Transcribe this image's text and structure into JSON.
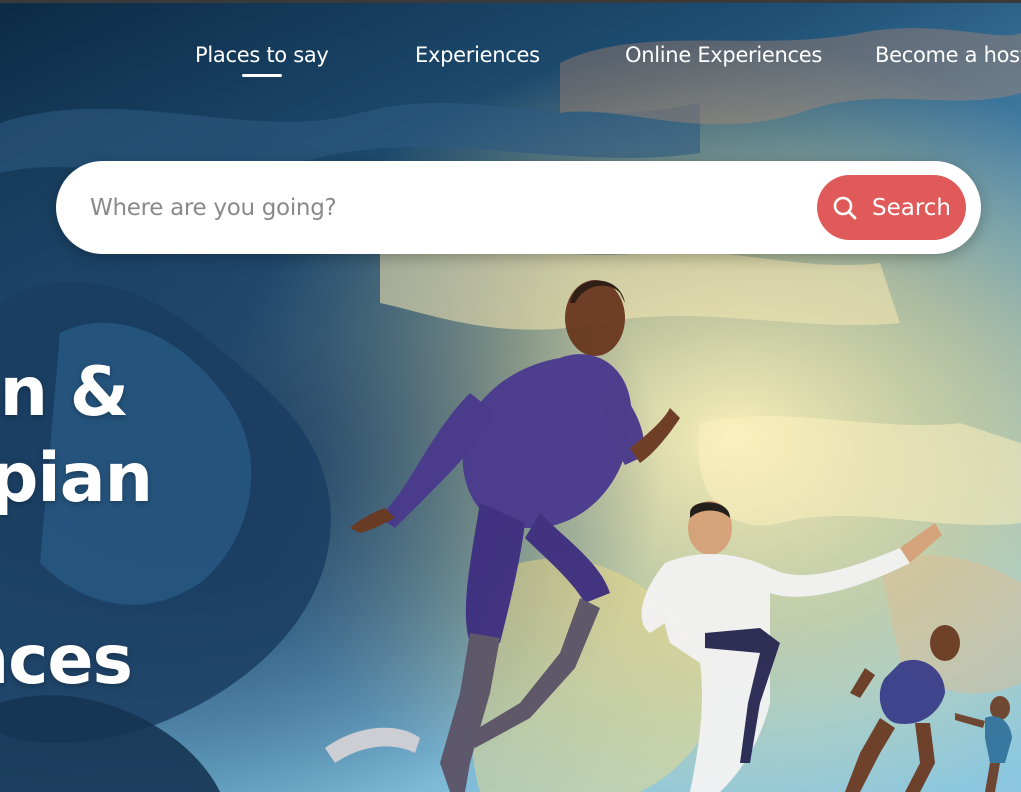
{
  "nav": {
    "items": [
      {
        "label": "Places to say",
        "active": true
      },
      {
        "label": "Experiences",
        "active": false
      },
      {
        "label": "Online Experiences",
        "active": false
      },
      {
        "label": "Become a host",
        "active": false
      }
    ]
  },
  "search": {
    "placeholder": "Where are you going?",
    "value": "",
    "button_label": "Search",
    "button_icon": "search-icon"
  },
  "hero": {
    "headline_lines": [
      "an &",
      "pian",
      "nces"
    ],
    "illustration": "athletes-running-illustration"
  },
  "colors": {
    "accent": "#e05a5a",
    "sky_dark": "#123a5c",
    "text_on_hero": "#ffffff"
  }
}
